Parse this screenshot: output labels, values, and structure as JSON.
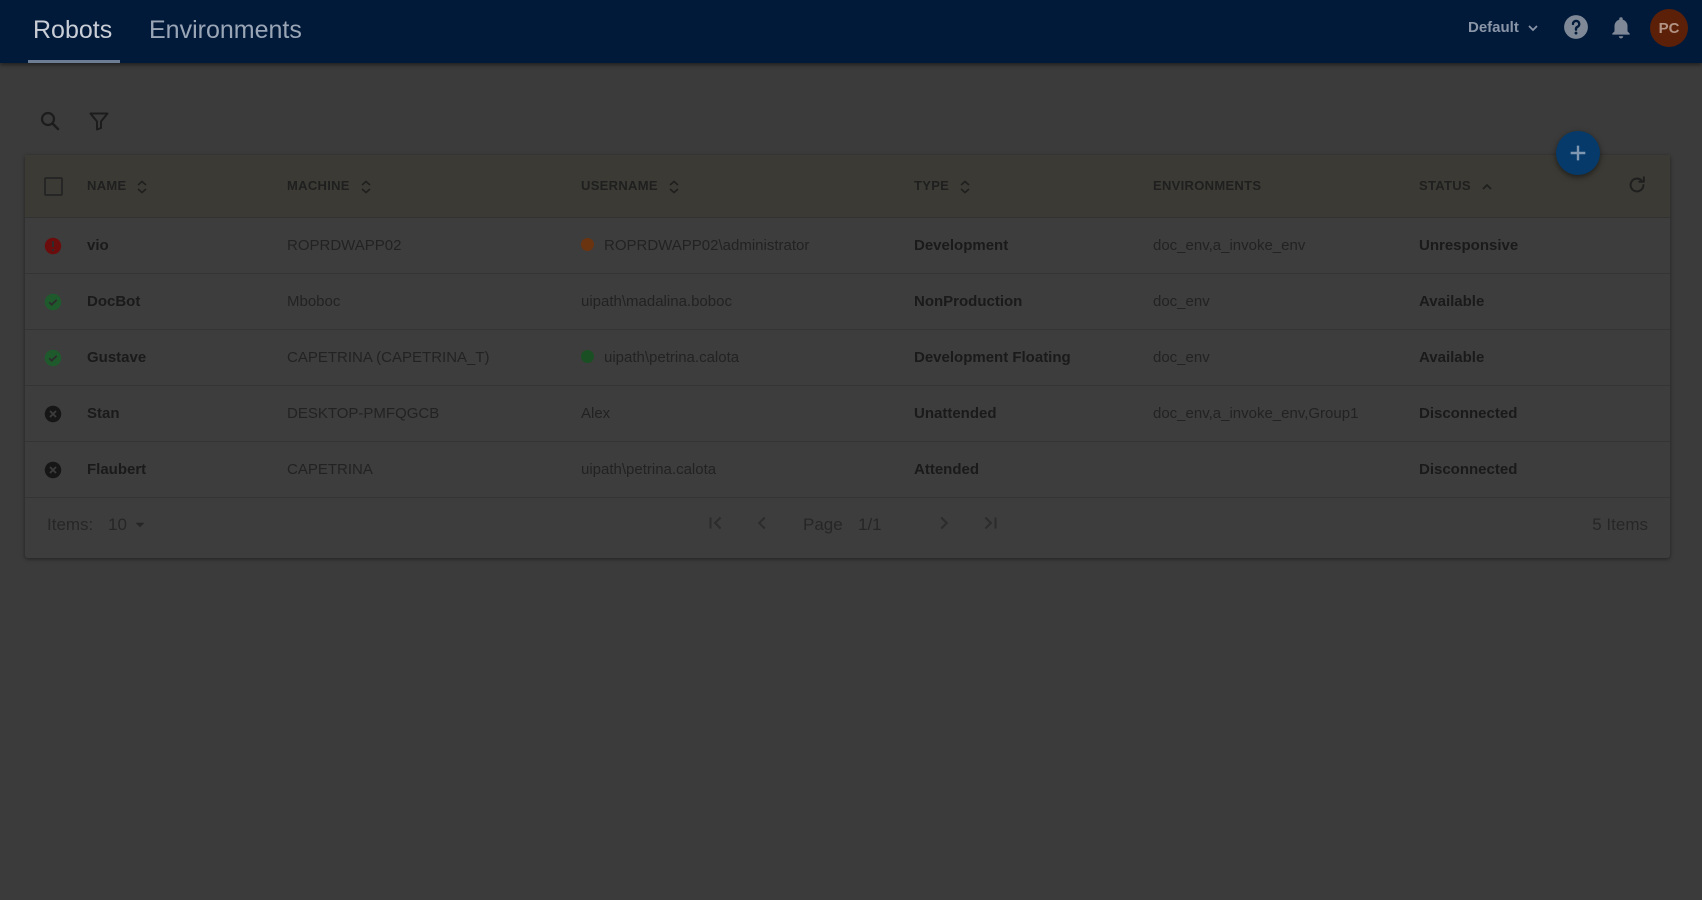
{
  "header": {
    "tabs": [
      {
        "label": "Robots"
      },
      {
        "label": "Environments"
      }
    ],
    "tenant": "Default",
    "avatar_initials": "PC"
  },
  "table": {
    "columns": {
      "name": "NAME",
      "machine": "MACHINE",
      "username": "USERNAME",
      "type": "TYPE",
      "environments": "ENVIRONMENTS",
      "status": "STATUS"
    },
    "rows": [
      {
        "status_icon": "error-icon",
        "name": "vio",
        "machine": "ROPRDWAPP02",
        "user_dot": "orange",
        "username": "ROPRDWAPP02\\administrator",
        "type": "Development",
        "environments": "doc_env,a_invoke_env",
        "status": "Unresponsive"
      },
      {
        "status_icon": "check-circle-icon",
        "name": "DocBot",
        "machine": "Mboboc",
        "user_dot": "",
        "username": "uipath\\madalina.boboc",
        "type": "NonProduction",
        "environments": "doc_env",
        "status": "Available"
      },
      {
        "status_icon": "check-circle-icon",
        "name": "Gustave",
        "machine": "CAPETRINA (CAPETRINA_T)",
        "user_dot": "green",
        "username": "uipath\\petrina.calota",
        "type": "Development Floating",
        "environments": "doc_env",
        "status": "Available"
      },
      {
        "status_icon": "cancel-circle-icon",
        "name": "Stan",
        "machine": "DESKTOP-PMFQGCB",
        "user_dot": "",
        "username": "Alex",
        "type": "Unattended",
        "environments": "doc_env,a_invoke_env,Group1",
        "status": "Disconnected"
      },
      {
        "status_icon": "cancel-circle-icon",
        "name": "Flaubert",
        "machine": "CAPETRINA",
        "user_dot": "",
        "username": "uipath\\petrina.calota",
        "type": "Attended",
        "environments": "",
        "status": "Disconnected"
      }
    ]
  },
  "footer": {
    "items_label": "Items:",
    "items_per_page": "10",
    "page_label": "Page",
    "page_value": "1/1",
    "total": "5 Items"
  },
  "colors": {
    "header_bg": "#021a3a",
    "fab_bg": "#063a6a",
    "error": "#6b0d0d",
    "success": "#1f5a2c",
    "orange_dot": "#6b3410",
    "green_dot": "#1a4f24"
  }
}
